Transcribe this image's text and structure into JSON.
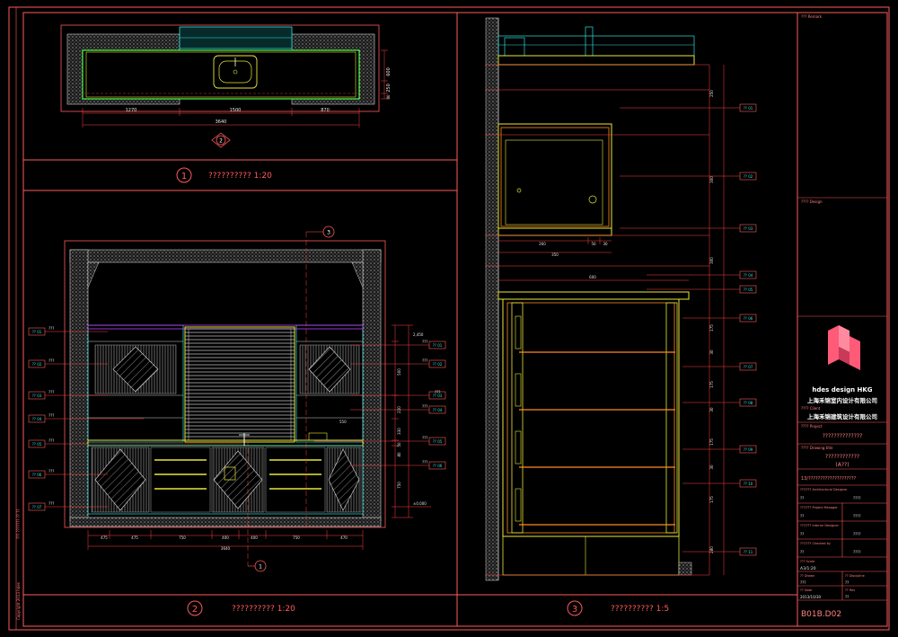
{
  "colors": {
    "frame": "#ff5a5a",
    "dim": "#ff4040",
    "wall": "#d8d8d8",
    "green": "#4cff4c",
    "yellow": "#e8e838",
    "cyan": "#30e0e0",
    "orange": "#ff8a20",
    "magenta": "#c040ff",
    "white": "#ffffff",
    "brand": "#ff5a78"
  },
  "view1": {
    "number": "1",
    "title": "??????????  1:20",
    "dims": [
      "1270",
      "1500",
      "870"
    ],
    "total": "3640",
    "side_dims": [
      "600",
      "250",
      "80"
    ],
    "marker": "2"
  },
  "view2": {
    "number": "2",
    "title": "??????????  1:20",
    "bottom_dims": [
      "475",
      "475",
      "750",
      "400",
      "400",
      "750",
      "470"
    ],
    "total": "3640",
    "section_marker": "3",
    "section_marker_bottom": "1",
    "left_tags": [
      "???",
      "???",
      "???",
      "???",
      "???",
      "???",
      "???"
    ],
    "left_codes": [
      "?? 01",
      "?? 02",
      "?? 03",
      "?? 04",
      "?? 05",
      "?? 06",
      "?? 07"
    ],
    "right_tags": [
      "???",
      "???",
      "???",
      "???",
      "???",
      "???"
    ],
    "right_codes": [
      "?? 01",
      "?? 02",
      "?? 03",
      "?? 04",
      "?? 05",
      "?? 06"
    ],
    "right_dims": [
      "2,450",
      "500",
      "220",
      "330",
      "50",
      "80",
      "750"
    ],
    "level": "±0.000",
    "inner_dim": "550"
  },
  "view3": {
    "number": "3",
    "title": "??????????  1:5",
    "dims_top": [
      "260",
      "50",
      "30",
      "350"
    ],
    "width": "600",
    "right_dims": [
      "250",
      "300",
      "300",
      "175",
      "30",
      "175",
      "30",
      "175",
      "30",
      "175",
      "280"
    ],
    "codes": [
      "?? 01",
      "?? 02",
      "?? 03",
      "?? 04",
      "?? 05",
      "?? 06",
      "?? 07",
      "?? 08",
      "?? 09",
      "?? 10",
      "?? 11"
    ]
  },
  "title_block": {
    "remark_label": "??? Remark",
    "remark": "",
    "design_label": "???? Design",
    "logo_text": "hdes design HKG",
    "company1": "上海禾锦室内设计有限公司",
    "company2": "上海禾锦建筑设计有限公司",
    "client_label": "???? Client",
    "project_label": "???? Project",
    "project": "??????????????",
    "drawing_label": "???? Drawing title",
    "drawing": "????????????",
    "area": "(A??)",
    "sheet_name": "13/????????????????????",
    "rows": [
      {
        "label": "???/??? Architectural Designer",
        "value": "??",
        "sig": "????"
      },
      {
        "label": "???/??? Project Manager",
        "value": "??",
        "sig": "????"
      },
      {
        "label": "???/??? Interior Designer",
        "value": "??",
        "sig": "????"
      },
      {
        "label": "???/??? Checked by",
        "value": "??",
        "sig": "????"
      }
    ],
    "scale_label": "??? Scale",
    "scale": "A3/1:20",
    "drawn_label": "?? Drawn",
    "drawn": "???",
    "discipline_label": "?? Discipline",
    "discipline": "??",
    "date_label": "?? Date",
    "date": "2013/10/30",
    "rev_label": "?? Rev",
    "rev": "??",
    "drawing_no": "B01B.D02"
  },
  "left_strip": [
    "Copyright 2013 hdes",
    "??? ??????? ?? ??"
  ]
}
